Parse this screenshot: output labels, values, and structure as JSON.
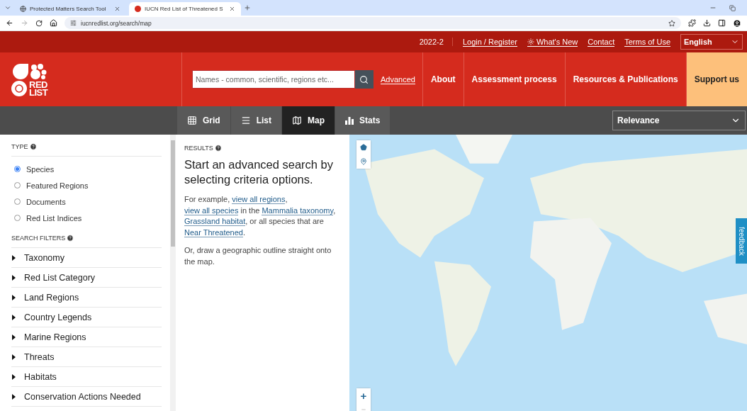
{
  "browser": {
    "tabs": [
      {
        "title": "Protected Matters Search Tool",
        "selected": false
      },
      {
        "title": "IUCN Red List of Threatened S",
        "selected": true
      }
    ],
    "url": "iucnredlist.org/search/map"
  },
  "topbar": {
    "version": "2022-2",
    "links": [
      {
        "label": "Login / Register",
        "kind": "plain"
      },
      {
        "label": "What's New",
        "kind": "news"
      },
      {
        "label": "Contact",
        "kind": "plain"
      },
      {
        "label": "Terms of Use",
        "kind": "plain"
      }
    ],
    "language": "English"
  },
  "header": {
    "logo": [
      "RED",
      "LIST"
    ],
    "search": {
      "placeholder": "Names - common, scientific, regions etc..."
    },
    "advanced": "Advanced",
    "nav": [
      {
        "label": "About",
        "kind": "link"
      },
      {
        "label": "Assessment process",
        "kind": "link"
      },
      {
        "label": "Resources & Publications",
        "kind": "link"
      },
      {
        "label": "Support us",
        "kind": "highlight"
      }
    ]
  },
  "viewbar": {
    "views": [
      {
        "label": "Grid",
        "kind": "grid",
        "selected": false
      },
      {
        "label": "List",
        "kind": "list",
        "selected": false
      },
      {
        "label": "Map",
        "kind": "map",
        "selected": true
      },
      {
        "label": "Stats",
        "kind": "stats",
        "selected": false
      }
    ],
    "sort": "Relevance"
  },
  "sidebar": {
    "type_heading": "TYPE",
    "types": [
      {
        "label": "Species",
        "selected": true
      },
      {
        "label": "Featured Regions",
        "selected": false
      },
      {
        "label": "Documents",
        "selected": false
      },
      {
        "label": "Red List Indices",
        "selected": false
      }
    ],
    "filters_heading": "SEARCH FILTERS",
    "filters": [
      {
        "label": "Taxonomy",
        "expanded": false
      },
      {
        "label": "Red List Category",
        "expanded": false
      },
      {
        "label": "Land Regions",
        "expanded": false
      },
      {
        "label": "Country Legends",
        "expanded": false
      },
      {
        "label": "Marine Regions",
        "expanded": false
      },
      {
        "label": "Threats",
        "expanded": false
      },
      {
        "label": "Habitats",
        "expanded": false
      },
      {
        "label": "Conservation Actions Needed",
        "expanded": false
      }
    ]
  },
  "results": {
    "heading": "RESULTS",
    "title": "Start an advanced search by selecting criteria options.",
    "intro": [
      {
        "text": "For example, ",
        "link": false
      },
      {
        "text": "view all regions",
        "link": true
      },
      {
        "text": ", ",
        "link": false
      },
      {
        "text": "view all species",
        "link": true
      },
      {
        "text": " in the ",
        "link": false
      },
      {
        "text": "Mammalia taxonomy",
        "link": true
      },
      {
        "text": ", ",
        "link": false
      },
      {
        "text": "Grassland habitat",
        "link": true
      },
      {
        "text": ", or all species that are ",
        "link": false
      },
      {
        "text": "Near Threatened",
        "link": true
      },
      {
        "text": ".",
        "link": false
      }
    ],
    "outro": "Or, draw a geographic outline straight onto the map."
  },
  "map": {
    "zoom_in": "+",
    "feedback": "feedback"
  }
}
